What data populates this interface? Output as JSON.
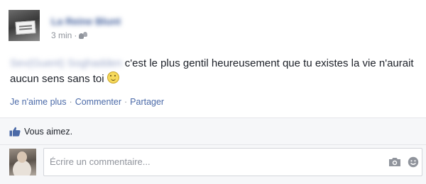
{
  "post": {
    "author_name": "La Reine Blunt",
    "timestamp": "3 min",
    "separator": "·",
    "audience_icon": "friends-icon",
    "tagged_name": "Sev(Guent) Soghadden",
    "text_part1": "c'est le plus gentil heureusement que tu existes la vie n'aurait aucun sens sans toi",
    "emoji_icon": "smiley-icon"
  },
  "actions": {
    "unlike": "Je n'aime plus",
    "comment": "Commenter",
    "share": "Partager",
    "separator": "·"
  },
  "likes": {
    "icon": "thumbs-up-icon",
    "text": "Vous aimez."
  },
  "comment_box": {
    "placeholder": "Écrire un commentaire...",
    "camera_icon": "camera-icon",
    "emoji_icon": "emoji-icon"
  },
  "colors": {
    "link": "#4b6aa8",
    "muted": "#90949c",
    "bar_bg": "#f6f7f9",
    "accent_blue": "#3b5998"
  }
}
